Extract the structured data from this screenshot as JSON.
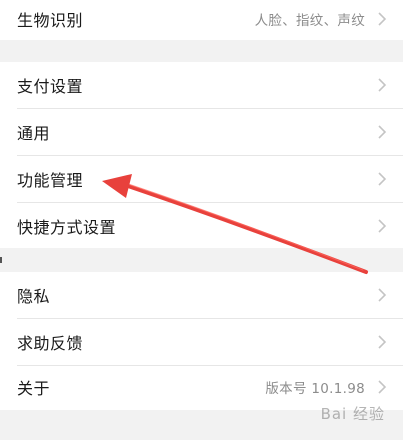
{
  "settings": {
    "biometrics": {
      "label": "生物识别",
      "value": "人脸、指纹、声纹"
    },
    "payment": {
      "label": "支付设置"
    },
    "general": {
      "label": "通用"
    },
    "feature_management": {
      "label": "功能管理"
    },
    "shortcuts": {
      "label": "快捷方式设置"
    },
    "privacy": {
      "label": "隐私"
    },
    "help_feedback": {
      "label": "求助反馈"
    },
    "about": {
      "label": "关于",
      "value": "版本号 10.1.98"
    }
  },
  "watermark_text": "Bai 经验",
  "annotation": {
    "arrow_color": "#e8413c",
    "target": "功能管理"
  },
  "colors": {
    "background": "#f2f2f2",
    "row": "#ffffff",
    "label_text": "#1a1a1a",
    "secondary_text": "#8c8c8c",
    "chevron": "#c4c4c4"
  }
}
